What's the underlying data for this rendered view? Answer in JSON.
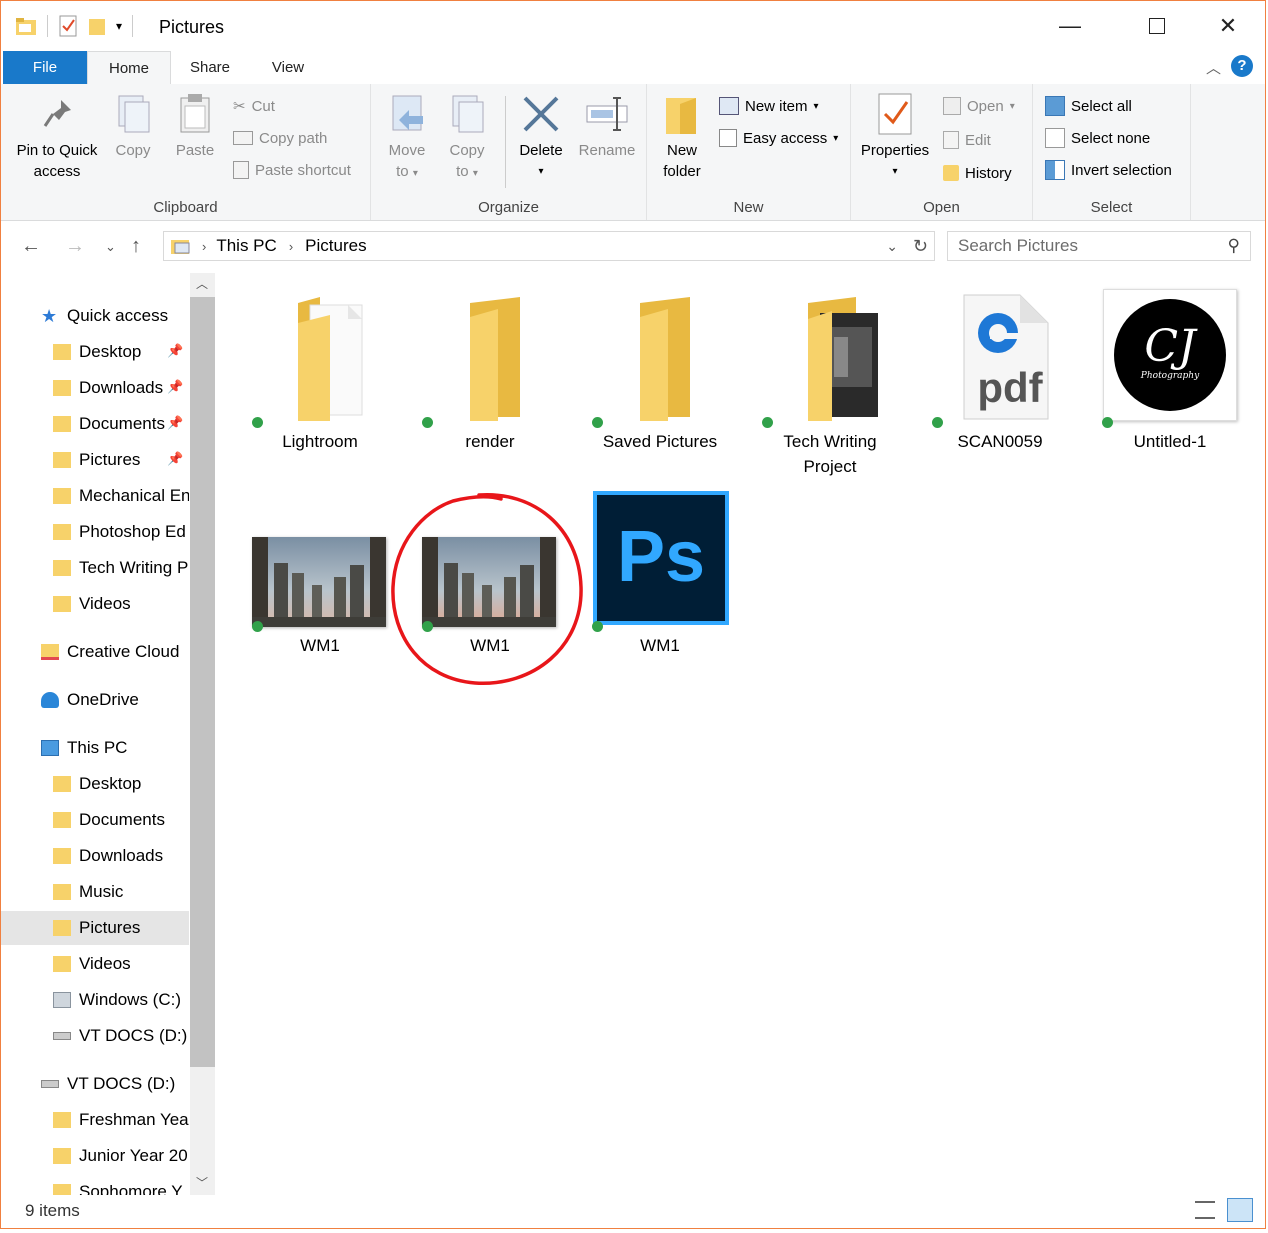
{
  "window": {
    "title": "Pictures"
  },
  "tabs": {
    "file": "File",
    "home": "Home",
    "share": "Share",
    "view": "View",
    "help": "?"
  },
  "ribbon": {
    "clipboard": {
      "label": "Clipboard",
      "pin_line1": "Pin to Quick",
      "pin_line2": "access",
      "copy": "Copy",
      "paste": "Paste",
      "cut": "Cut",
      "copy_path": "Copy path",
      "paste_shortcut": "Paste shortcut"
    },
    "organize": {
      "label": "Organize",
      "move_line1": "Move",
      "move_line2": "to",
      "copy_line1": "Copy",
      "copy_line2": "to",
      "delete": "Delete",
      "rename": "Rename"
    },
    "new": {
      "label": "New",
      "new_folder_line1": "New",
      "new_folder_line2": "folder",
      "new_item": "New item",
      "easy_access": "Easy access"
    },
    "open": {
      "label": "Open",
      "properties": "Properties",
      "open": "Open",
      "edit": "Edit",
      "history": "History"
    },
    "select": {
      "label": "Select",
      "select_all": "Select all",
      "select_none": "Select none",
      "invert": "Invert selection"
    }
  },
  "address": {
    "crumbs": [
      "This PC",
      "Pictures"
    ],
    "search_placeholder": "Search Pictures"
  },
  "nav": {
    "quick_access": "Quick access",
    "quick_items": [
      "Desktop",
      "Downloads",
      "Documents",
      "Pictures",
      "Mechanical Eng",
      "Photoshop Ed",
      "Tech Writing P",
      "Videos"
    ],
    "creative_cloud": "Creative Cloud",
    "onedrive": "OneDrive",
    "this_pc": "This PC",
    "pc_items": [
      "Desktop",
      "Documents",
      "Downloads",
      "Music",
      "Pictures",
      "Videos",
      "Windows (C:)",
      "VT DOCS (D:)"
    ],
    "drive": "VT DOCS (D:)",
    "drive_items": [
      "Freshman Year",
      "Junior Year 20",
      "Sophomore Y"
    ]
  },
  "files": [
    {
      "name": "Lightroom",
      "line2": ""
    },
    {
      "name": "render",
      "line2": ""
    },
    {
      "name": "Saved Pictures",
      "line2": ""
    },
    {
      "name": "Tech Writing",
      "line2": "Project"
    },
    {
      "name": "SCAN0059",
      "line2": ""
    },
    {
      "name": "Untitled-1",
      "line2": ""
    },
    {
      "name": "WM1",
      "line2": ""
    },
    {
      "name": "WM1",
      "line2": ""
    },
    {
      "name": "WM1",
      "line2": ""
    }
  ],
  "icons": {
    "pdf_text": "pdf",
    "ps_text": "Ps",
    "logo_text": "CJ",
    "logo_sub": "Photography"
  },
  "status": {
    "count": "9 items"
  },
  "colors": {
    "accent": "#1979ca",
    "folder": "#f7d26a",
    "sync": "#31a14a",
    "annotation": "#e8161a",
    "ps_bg": "#001e36",
    "ps_border": "#31a8ff"
  }
}
